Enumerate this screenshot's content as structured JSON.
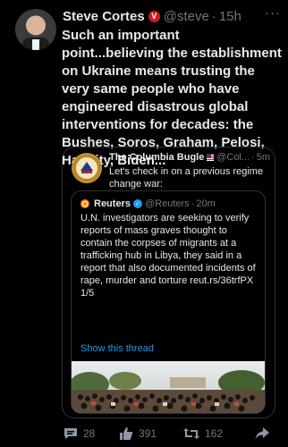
{
  "tweet": {
    "author_name": "Steve Cortes",
    "badge": "V",
    "handle": "@steve",
    "separator": "·",
    "time": "15h",
    "more": "···",
    "text": "Such an important point...believing the establishment on Ukraine means trusting the very same people who have engineered disastrous global interventions for decades: the Bushes, Soros, Graham, Pelosi, Hannity, Biden..."
  },
  "quote": {
    "author_name": "The Columbia Bugle",
    "handle": "@Col...",
    "separator": "·",
    "time": "5m",
    "text": "Let's check in on a previous regime change war:",
    "inner": {
      "author_name": "Reuters",
      "handle": "@Reuters",
      "separator": "·",
      "time": "20m",
      "text": "U.N. investigators are seeking to verify reports of mass graves thought to contain the corpses of migrants at a trafficking hub in Libya, they said in a report that also documented incidents of rape, murder and torture reut.rs/36trfPX 1/5",
      "show_thread": "Show this thread"
    }
  },
  "actions": {
    "replies": "28",
    "likes": "391",
    "retweets": "162"
  },
  "colors": {
    "background": "#000000",
    "text": "#e7e9ea",
    "muted": "#71767b",
    "link": "#1d9bf0",
    "border": "#2f3336"
  },
  "icons": [
    "reply-icon",
    "like-icon",
    "retweet-icon",
    "share-icon",
    "more-icon",
    "verified-icon"
  ]
}
